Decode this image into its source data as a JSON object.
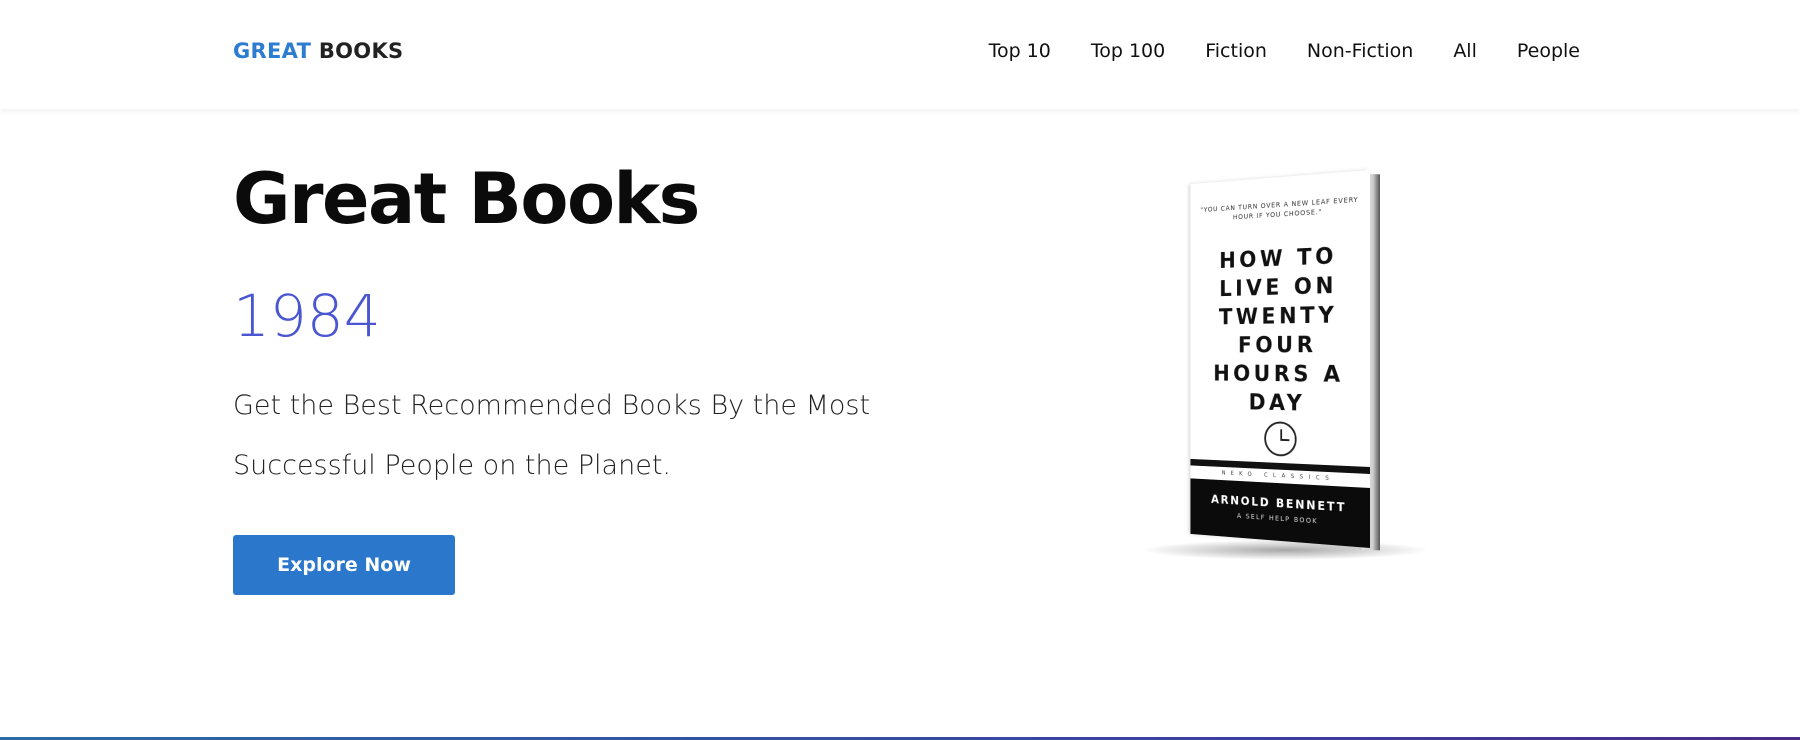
{
  "logo": {
    "part1": "GREAT",
    "part2": "BOOKS"
  },
  "nav": [
    "Top 10",
    "Top 100",
    "Fiction",
    "Non-Fiction",
    "All",
    "People"
  ],
  "hero": {
    "title": "Great Books",
    "year": "1984",
    "subtitle": "Get the Best Recommended Books By the Most Successful People on the Planet.",
    "cta": "Explore Now"
  },
  "book": {
    "quote": "\"YOU CAN TURN OVER A NEW LEAF EVERY HOUR IF YOU CHOOSE.\"",
    "title": "HOW TO LIVE ON TWENTY FOUR HOURS A DAY",
    "publisher": "NEKO CLASSICS",
    "author": "ARNOLD BENNETT",
    "subtitle": "A SELF HELP BOOK"
  },
  "colors": {
    "brand_blue": "#2c7dd1",
    "year_color": "#4a56d1",
    "button_bg": "#2b77cc"
  }
}
